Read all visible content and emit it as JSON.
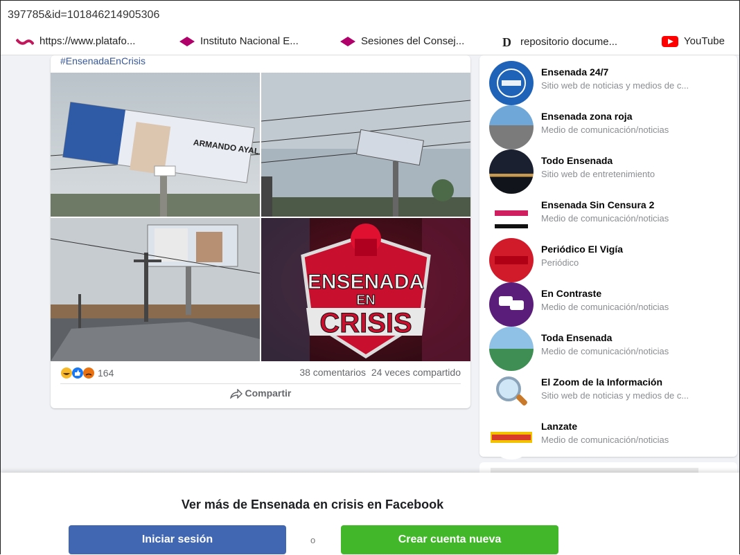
{
  "browser": {
    "url_fragment": "397785&id=101846214905306",
    "bookmarks": [
      {
        "label": "https://www.platafo...",
        "icon": "wave-icon",
        "color": "#c2185b"
      },
      {
        "label": "Instituto Nacional E...",
        "icon": "diamond-icon",
        "color": "#b0006a"
      },
      {
        "label": "Sesiones del Consej...",
        "icon": "diamond-icon",
        "color": "#b0006a"
      },
      {
        "label": "repositorio docume...",
        "icon": "d-logo-icon",
        "color": "#222222"
      },
      {
        "label": "YouTube",
        "icon": "youtube-icon",
        "color": "#ff0000"
      }
    ]
  },
  "post": {
    "hashtag": "#EnsenadaEnCrisis",
    "reaction_count": "164",
    "comments": "38 comentarios",
    "shares": "24 veces compartido",
    "share_label": "Compartir",
    "billboard_text_1": "ARMANDO AYALA ROBLES",
    "logo_text_1": "ENSENADA",
    "logo_text_2": "EN",
    "logo_text_3": "CRISIS"
  },
  "sidebar": {
    "pages": [
      {
        "name": "Ensenada 24/7",
        "category": "Sitio web de noticias y medios de c..."
      },
      {
        "name": "Ensenada zona roja",
        "category": "Medio de comunicación/noticias"
      },
      {
        "name": "Todo Ensenada",
        "category": "Sitio web de entretenimiento"
      },
      {
        "name": "Ensenada Sin Censura 2",
        "category": "Medio de comunicación/noticias"
      },
      {
        "name": "Periódico El Vigía",
        "category": "Periódico"
      },
      {
        "name": "En Contraste",
        "category": "Medio de comunicación/noticias"
      },
      {
        "name": "Toda Ensenada",
        "category": "Medio de comunicación/noticias"
      },
      {
        "name": "El Zoom de la Información",
        "category": "Sitio web de noticias y medios de c..."
      },
      {
        "name": "Lanzate",
        "category": "Medio de comunicación/noticias"
      }
    ]
  },
  "overlay": {
    "title": "Ver más de Ensenada en crisis en Facebook",
    "login_label": "Iniciar sesión",
    "or_label": "o",
    "signup_label": "Crear cuenta nueva"
  },
  "colors": {
    "facebook_blue": "#4267b2",
    "signup_green": "#42b72a",
    "crisis_red": "#c8102e"
  }
}
